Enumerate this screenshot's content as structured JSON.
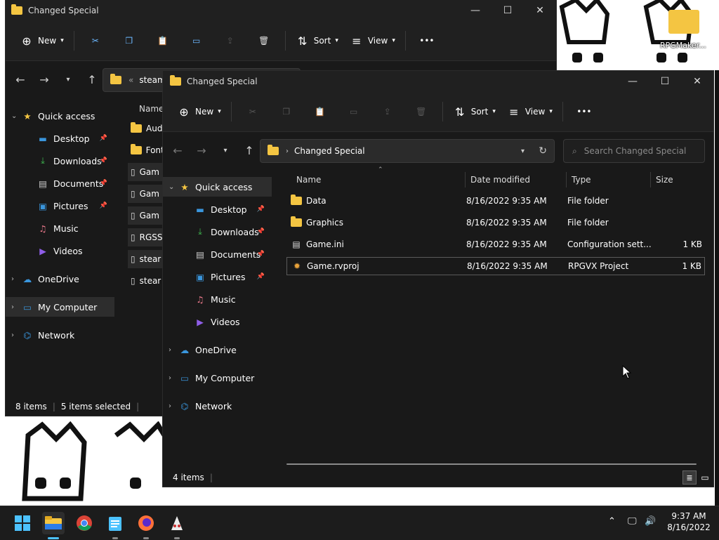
{
  "desktop": {
    "folder_label": "RPGMaker..."
  },
  "back_window": {
    "title": "Changed Special",
    "toolbar": {
      "new_label": "New",
      "sort_label": "Sort",
      "view_label": "View"
    },
    "address": {
      "path": "steamap"
    },
    "nav": [
      {
        "label": "Quick access",
        "icon": "star-icon",
        "expanded": true
      },
      {
        "label": "Desktop",
        "icon": "desktop-icon",
        "pinned": true
      },
      {
        "label": "Downloads",
        "icon": "download-icon",
        "pinned": true
      },
      {
        "label": "Documents",
        "icon": "document-icon",
        "pinned": true
      },
      {
        "label": "Pictures",
        "icon": "pictures-icon",
        "pinned": true
      },
      {
        "label": "Music",
        "icon": "music-icon"
      },
      {
        "label": "Videos",
        "icon": "videos-icon"
      },
      {
        "label": "OneDrive",
        "icon": "cloud-icon"
      },
      {
        "label": "My Computer",
        "icon": "computer-icon"
      },
      {
        "label": "Network",
        "icon": "network-icon"
      }
    ],
    "column_name": "Name",
    "files": [
      "Audi",
      "Fonts",
      "Gam",
      "Gam",
      "Gam",
      "RGSS",
      "stear",
      "stear"
    ],
    "status": {
      "items": "8 items",
      "selected": "5 items selected"
    }
  },
  "front_window": {
    "title": "Changed Special",
    "toolbar": {
      "new_label": "New",
      "sort_label": "Sort",
      "view_label": "View"
    },
    "address": {
      "path": "Changed Special"
    },
    "search": {
      "placeholder": "Search Changed Special"
    },
    "nav": [
      {
        "label": "Quick access",
        "icon": "star-icon",
        "expanded": true
      },
      {
        "label": "Desktop",
        "icon": "desktop-icon",
        "pinned": true
      },
      {
        "label": "Downloads",
        "icon": "download-icon",
        "pinned": true
      },
      {
        "label": "Documents",
        "icon": "document-icon",
        "pinned": true
      },
      {
        "label": "Pictures",
        "icon": "pictures-icon",
        "pinned": true
      },
      {
        "label": "Music",
        "icon": "music-icon"
      },
      {
        "label": "Videos",
        "icon": "videos-icon"
      },
      {
        "label": "OneDrive",
        "icon": "cloud-icon"
      },
      {
        "label": "My Computer",
        "icon": "computer-icon"
      },
      {
        "label": "Network",
        "icon": "network-icon"
      }
    ],
    "columns": {
      "name": "Name",
      "date": "Date modified",
      "type": "Type",
      "size": "Size"
    },
    "files": [
      {
        "name": "Data",
        "date": "8/16/2022 9:35 AM",
        "type": "File folder",
        "size": "",
        "icon": "folder-icon"
      },
      {
        "name": "Graphics",
        "date": "8/16/2022 9:35 AM",
        "type": "File folder",
        "size": "",
        "icon": "folder-icon"
      },
      {
        "name": "Game.ini",
        "date": "8/16/2022 9:35 AM",
        "type": "Configuration sett...",
        "size": "1 KB",
        "icon": "ini-file-icon"
      },
      {
        "name": "Game.rvproj",
        "date": "8/16/2022 9:35 AM",
        "type": "RPGVX Project",
        "size": "1 KB",
        "icon": "rvproj-file-icon"
      }
    ],
    "status": {
      "items": "4 items"
    }
  },
  "taskbar": {
    "apps": [
      "start-icon",
      "file-explorer-icon",
      "chrome-icon",
      "notepad-icon",
      "firefox-icon",
      "rpgmaker-icon"
    ],
    "clock": {
      "time": "9:37 AM",
      "date": "8/16/2022"
    }
  },
  "colors": {
    "window_bg": "#191919",
    "chrome_bg": "#202020",
    "folder": "#f4c542",
    "accent": "#4cc2ff",
    "taskbar": "#1c1c1c"
  }
}
